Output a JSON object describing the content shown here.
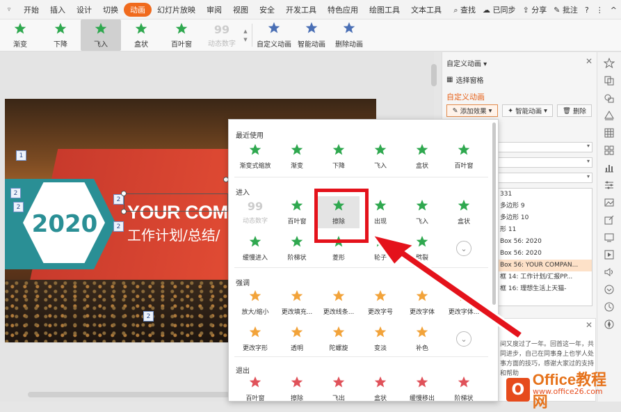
{
  "menubar": {
    "lead": "▿",
    "tabs": [
      "开始",
      "插入",
      "设计",
      "切换",
      "动画",
      "幻灯片放映",
      "审阅",
      "视图",
      "安全",
      "开发工具",
      "特色应用",
      "绘图工具",
      "文本工具"
    ],
    "active": "动画",
    "search": "查找",
    "synced": "已同步",
    "share": "分享",
    "comment": "批注",
    "help": "?",
    "more": "⋮",
    "collapse": "^"
  },
  "ribbon": {
    "effects": [
      {
        "label": "渐变",
        "icon": "fade-star-icon"
      },
      {
        "label": "下降",
        "icon": "descend-star-icon"
      },
      {
        "label": "飞入",
        "icon": "fly-in-star-icon",
        "selected": true
      },
      {
        "label": "盒状",
        "icon": "box-star-icon"
      },
      {
        "label": "百叶窗",
        "icon": "blinds-star-icon"
      },
      {
        "label": "动态数字",
        "icon": "dynamic-number-icon",
        "disabled": true
      }
    ],
    "big": [
      {
        "label": "自定义动画",
        "icon": "custom-animation-icon"
      },
      {
        "label": "智能动画",
        "icon": "smart-animation-icon"
      },
      {
        "label": "删除动画",
        "icon": "delete-animation-icon"
      }
    ]
  },
  "slide": {
    "year": "2020",
    "title_en": "YOUR COMP",
    "title_cn": "工作计划/总结/",
    "markers": [
      "1",
      "2",
      "2",
      "2",
      "2",
      "2"
    ]
  },
  "panel": {
    "title": "自定义动画",
    "select_pane": "选择窗格",
    "section": "自定义动画",
    "add_effect": "添加效果",
    "smart_animation": "智能动画",
    "delete": "删除",
    "list": [
      "331",
      "多边形 9",
      "多边形 10",
      "形 11",
      "Box 56: 2020",
      "Box 56: 2020",
      "Box 56: YOUR COMPAN...",
      "框 14: 工作计划/汇报PP...",
      "框 16: 理想生活上天猫-"
    ],
    "help_text": "间又度过了一年。回首这一年，共同进步，自己在同事身上也学人处事方面的技巧，感谢大家过的支持和帮助"
  },
  "dropdown": {
    "recent_title": "最近使用",
    "recent": [
      {
        "label": "渐变式缩放",
        "icon": "fade-zoom-icon"
      },
      {
        "label": "渐变",
        "icon": "fade-icon"
      },
      {
        "label": "下降",
        "icon": "descend-icon"
      },
      {
        "label": "飞入",
        "icon": "fly-in-icon"
      },
      {
        "label": "盒状",
        "icon": "box-icon"
      },
      {
        "label": "百叶窗",
        "icon": "blinds-icon"
      }
    ],
    "enter_title": "进入",
    "enter": [
      {
        "label": "动态数字",
        "icon": "dynamic-number-icon",
        "disabled": true
      },
      {
        "label": "百叶窗",
        "icon": "blinds-icon"
      },
      {
        "label": "擦除",
        "icon": "wipe-icon",
        "highlight": true
      },
      {
        "label": "出现",
        "icon": "appear-icon"
      },
      {
        "label": "飞入",
        "icon": "fly-in-icon"
      },
      {
        "label": "盒状",
        "icon": "box-icon"
      },
      {
        "label": "缓慢进入",
        "icon": "slow-in-icon"
      },
      {
        "label": "阶梯状",
        "icon": "stairs-icon"
      },
      {
        "label": "菱形",
        "icon": "diamond-icon"
      },
      {
        "label": "轮子",
        "icon": "wheel-icon"
      },
      {
        "label": "劈裂",
        "icon": "split-icon"
      }
    ],
    "emphasis_title": "强调",
    "emphasis": [
      {
        "label": "放大/缩小",
        "icon": "grow-shrink-icon"
      },
      {
        "label": "更改填充...",
        "icon": "change-fill-icon"
      },
      {
        "label": "更改线条...",
        "icon": "change-line-icon"
      },
      {
        "label": "更改字号",
        "icon": "change-font-size-icon"
      },
      {
        "label": "更改字体",
        "icon": "change-font-icon"
      },
      {
        "label": "更改字体...",
        "icon": "change-font-color-icon"
      },
      {
        "label": "更改字形",
        "icon": "change-font-style-icon"
      },
      {
        "label": "透明",
        "icon": "transparent-icon"
      },
      {
        "label": "陀螺旋",
        "icon": "spin-icon"
      },
      {
        "label": "变淡",
        "icon": "lighten-icon"
      },
      {
        "label": "补色",
        "icon": "complementary-color-icon"
      }
    ],
    "exit_title": "退出",
    "exit": [
      {
        "label": "百叶窗",
        "icon": "blinds-icon"
      },
      {
        "label": "擦除",
        "icon": "wipe-icon"
      },
      {
        "label": "飞出",
        "icon": "fly-out-icon"
      },
      {
        "label": "盒状",
        "icon": "box-icon"
      },
      {
        "label": "缓慢移出",
        "icon": "slow-out-icon"
      },
      {
        "label": "阶梯状",
        "icon": "stairs-icon"
      }
    ]
  },
  "watermark": {
    "main": "Office教程网",
    "sub": "www.office26.com"
  },
  "colors": {
    "accent": "#f06a1d",
    "highlight_box": "#e4121b",
    "star_green": "#2fa84f"
  }
}
